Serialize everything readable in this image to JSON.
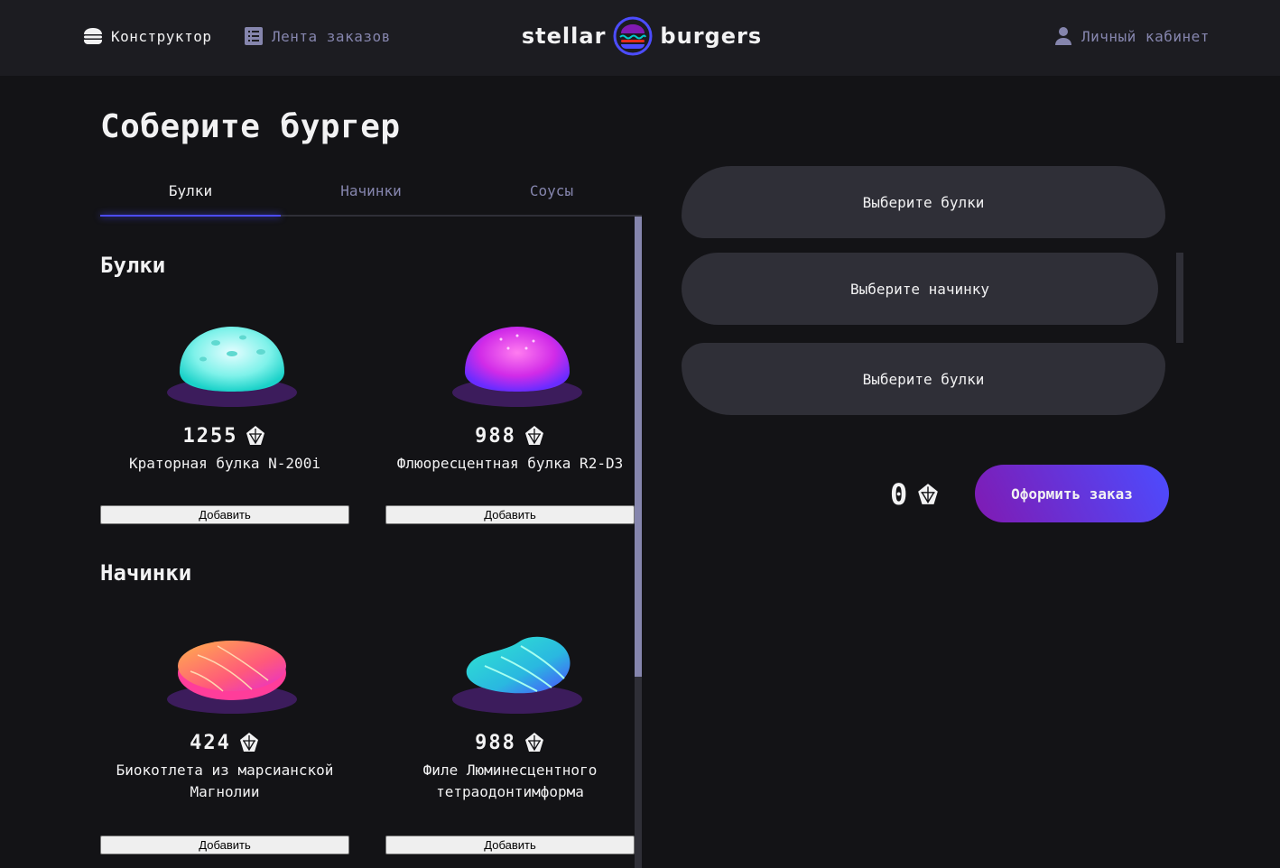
{
  "header": {
    "nav": {
      "constructor_label": "Конструктор",
      "feed_label": "Лента заказов",
      "profile_label": "Личный кабинет"
    },
    "logo": {
      "left": "stellar",
      "right": "burgers"
    }
  },
  "page_title": "Соберите бургер",
  "tabs": [
    {
      "label": "Булки",
      "active": true
    },
    {
      "label": "Начинки",
      "active": false
    },
    {
      "label": "Соусы",
      "active": false
    }
  ],
  "sections": {
    "buns": {
      "title": "Булки",
      "items": [
        {
          "price": "1255",
          "name": "Краторная булка N-200i",
          "add_label": "Добавить"
        },
        {
          "price": "988",
          "name": "Флюоресцентная булка R2-D3",
          "add_label": "Добавить"
        }
      ]
    },
    "mains": {
      "title": "Начинки",
      "items": [
        {
          "price": "424",
          "name": "Биокотлета из марсианской Магнолии",
          "add_label": "Добавить"
        },
        {
          "price": "988",
          "name": "Филе Люминесцентного тетраодонтимформа",
          "add_label": "Добавить"
        }
      ]
    }
  },
  "constructor": {
    "top_bun_placeholder": "Выберите булки",
    "filling_placeholder": "Выберите начинку",
    "bottom_bun_placeholder": "Выберите булки",
    "total": "0",
    "order_button": "Оформить заказ"
  },
  "colors": {
    "background": "#131316",
    "header": "#1c1c21",
    "slot": "#2f2f37",
    "inactive_text": "#8585ad",
    "accent": "#4c4cff",
    "order_gradient_start": "#801ab2"
  },
  "icons": [
    "burger-icon",
    "list-icon",
    "profile-icon",
    "currency-icon"
  ]
}
